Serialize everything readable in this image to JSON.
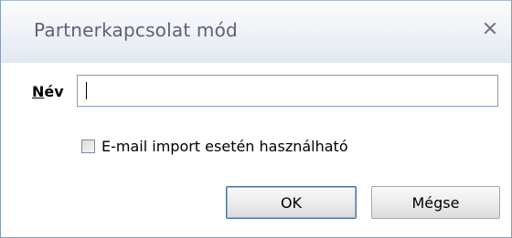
{
  "dialog": {
    "title": "Partnerkapcsolat mód",
    "close_icon": "close-icon"
  },
  "form": {
    "name_label_mnemonic": "N",
    "name_label_rest": "év",
    "name_value": "",
    "checkbox_label": "E-mail import esetén használható",
    "checkbox_checked": false
  },
  "buttons": {
    "ok_label": "OK",
    "cancel_label": "Mégse"
  }
}
